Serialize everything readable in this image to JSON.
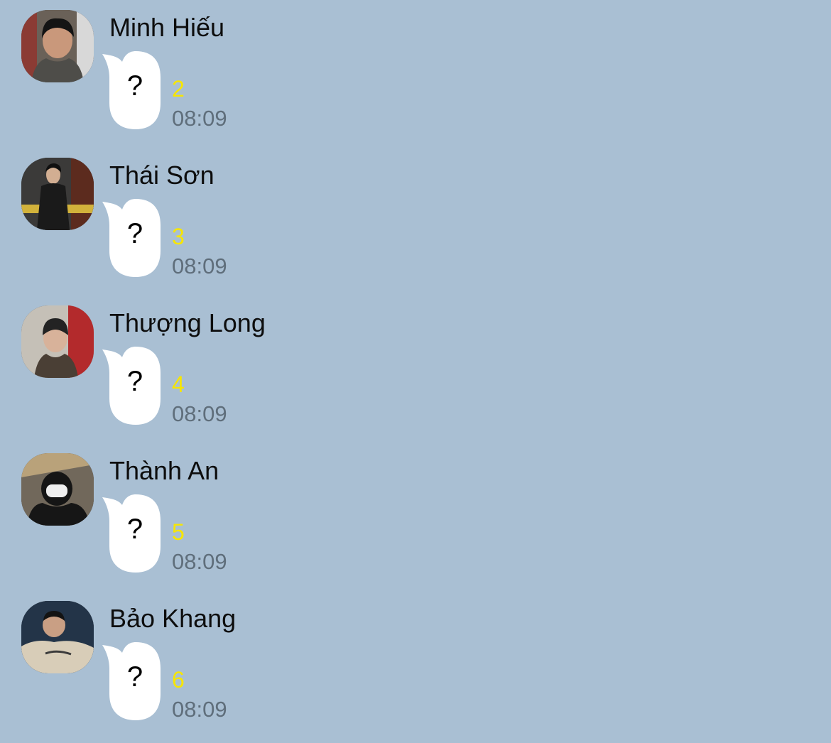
{
  "theme": {
    "background": "#a9bfd3",
    "bubble": "#ffffff",
    "unread_color": "#f7e600",
    "time_color": "#5f6e7b"
  },
  "messages": [
    {
      "sender": "Minh Hiếu",
      "avatar": "user-photo-icon",
      "text": "?",
      "unread": "2",
      "time": "08:09"
    },
    {
      "sender": "Thái Sơn",
      "avatar": "user-photo-icon",
      "text": "?",
      "unread": "3",
      "time": "08:09"
    },
    {
      "sender": "Thượng Long",
      "avatar": "user-photo-icon",
      "text": "?",
      "unread": "4",
      "time": "08:09"
    },
    {
      "sender": "Thành An",
      "avatar": "user-photo-icon",
      "text": "?",
      "unread": "5",
      "time": "08:09"
    },
    {
      "sender": "Bảo Khang",
      "avatar": "user-photo-icon",
      "text": "?",
      "unread": "6",
      "time": "08:09"
    }
  ]
}
